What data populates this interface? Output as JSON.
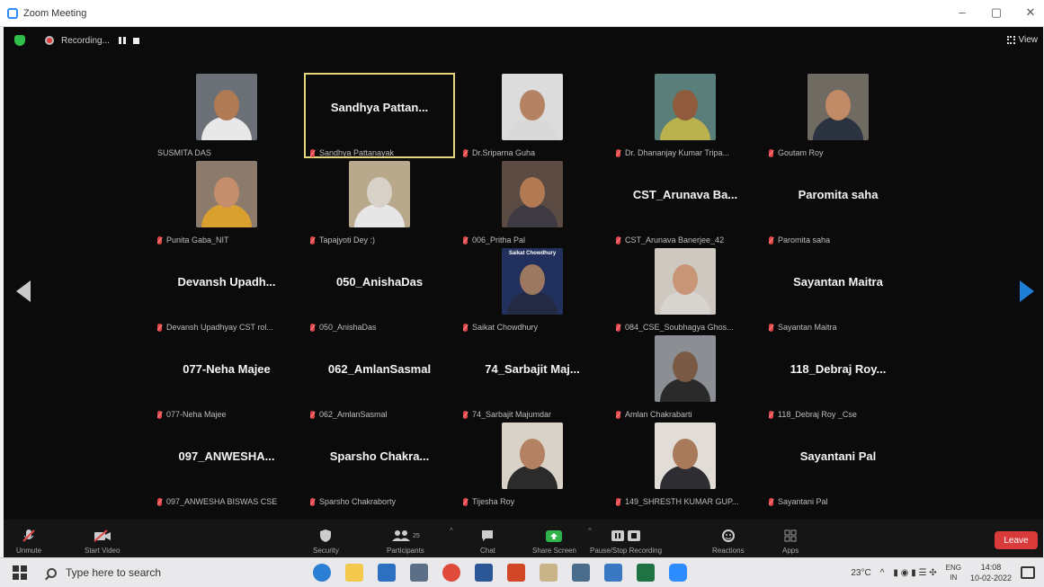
{
  "window": {
    "title": "Zoom Meeting",
    "controls": [
      "–",
      "▢",
      "✕"
    ]
  },
  "topbar": {
    "recording_label": "Recording...",
    "view_label": "View"
  },
  "participants": [
    {
      "name": "SUSMITA DAS",
      "display": "",
      "video": true,
      "active": false,
      "muted": false,
      "shirt": "#e8e8e8",
      "skin": "#b07a55",
      "bg": "#6b7076"
    },
    {
      "name": "Sandhya Pattanayak",
      "display": "Sandhya Pattan...",
      "video": false,
      "active": true,
      "muted": true
    },
    {
      "name": "Dr.Sriparna Guha",
      "display": "",
      "video": true,
      "active": false,
      "muted": true,
      "shirt": "#d9d9d9",
      "skin": "#b58363",
      "bg": "#dcdcdc"
    },
    {
      "name": "Dr. Dhananjay Kumar Tripa...",
      "display": "",
      "video": true,
      "active": false,
      "muted": true,
      "shirt": "#b9b24e",
      "skin": "#8f5b3c",
      "bg": "#5a7f7a"
    },
    {
      "name": "Goutam Roy",
      "display": "",
      "video": true,
      "active": false,
      "muted": true,
      "shirt": "#2c3340",
      "skin": "#c18b67",
      "bg": "#6f6b63"
    },
    {
      "name": "Punita Gaba_NIT",
      "display": "",
      "video": true,
      "active": false,
      "muted": true,
      "shirt": "#d9a030",
      "skin": "#c48d6b",
      "bg": "#8c7b6c"
    },
    {
      "name": "Tapajyoti Dey :)",
      "display": "",
      "video": true,
      "active": false,
      "muted": true,
      "shirt": "#e6e6e6",
      "skin": "#d7d1c7",
      "bg": "#b8a88c"
    },
    {
      "name": "006_Pritha Pal",
      "display": "",
      "video": true,
      "active": false,
      "muted": true,
      "shirt": "#3d3a44",
      "skin": "#b27a52",
      "bg": "#5c4b43"
    },
    {
      "name": "CST_Arunava Banerjee_42",
      "display": "CST_Arunava Ba...",
      "video": false,
      "active": false,
      "muted": true
    },
    {
      "name": "Paromita saha",
      "display": "Paromita saha",
      "video": false,
      "active": false,
      "muted": true
    },
    {
      "name": "Devansh Upadhyay CST rol...",
      "display": "Devansh Upadh...",
      "video": false,
      "active": false,
      "muted": true
    },
    {
      "name": "050_AnishaDas",
      "display": "050_AnishaDas",
      "video": false,
      "active": false,
      "muted": true
    },
    {
      "name": "Saikat Chowdhury",
      "display": "",
      "video": true,
      "active": false,
      "muted": true,
      "shirt": "#222a44",
      "skin": "#9c7860",
      "bg": "#22305e",
      "overlay": "Saikat Chowdhury"
    },
    {
      "name": "084_CSE_Soubhagya Ghos...",
      "display": "",
      "video": true,
      "active": false,
      "muted": true,
      "shirt": "#d8d4cf",
      "skin": "#c89676",
      "bg": "#cfc8c0"
    },
    {
      "name": "Sayantan Maitra",
      "display": "Sayantan Maitra",
      "video": false,
      "active": false,
      "muted": true
    },
    {
      "name": "077-Neha Majee",
      "display": "077-Neha Majee",
      "video": false,
      "active": false,
      "muted": true
    },
    {
      "name": "062_AmlanSasmal",
      "display": "062_AmlanSasmal",
      "video": false,
      "active": false,
      "muted": true
    },
    {
      "name": "74_Sarbajit Majumdar",
      "display": "74_Sarbajit Maj...",
      "video": false,
      "active": false,
      "muted": true
    },
    {
      "name": "Amlan Chakrabarti",
      "display": "",
      "video": true,
      "active": false,
      "muted": true,
      "shirt": "#2a2a2a",
      "skin": "#7a5a45",
      "bg": "#8b8f94"
    },
    {
      "name": "118_Debraj Roy _Cse",
      "display": "118_Debraj Roy...",
      "video": false,
      "active": false,
      "muted": true
    },
    {
      "name": "097_ANWESHA BISWAS CSE",
      "display": "097_ANWESHA...",
      "video": false,
      "active": false,
      "muted": true
    },
    {
      "name": "Sparsho Chakraborty",
      "display": "Sparsho Chakra...",
      "video": false,
      "active": false,
      "muted": true
    },
    {
      "name": "Tijesha Roy",
      "display": "",
      "video": true,
      "active": false,
      "muted": true,
      "shirt": "#2b2b2b",
      "skin": "#b48262",
      "bg": "#d9d2c8"
    },
    {
      "name": "149_SHRESTH KUMAR GUP...",
      "display": "",
      "video": true,
      "active": false,
      "muted": true,
      "shirt": "#2d2d32",
      "skin": "#a8795a",
      "bg": "#e1ddd6"
    },
    {
      "name": "Sayantani Pal",
      "display": "Sayantani Pal",
      "video": false,
      "active": false,
      "muted": true
    }
  ],
  "toolbar": {
    "unmute": "Unmute",
    "start_video": "Start Video",
    "security": "Security",
    "participants": "Participants",
    "participants_count": "25",
    "chat": "Chat",
    "share_screen": "Share Screen",
    "pause_recording": "Pause/Stop Recording",
    "reactions": "Reactions",
    "apps": "Apps",
    "leave": "Leave"
  },
  "taskbar": {
    "search_placeholder": "Type here to search",
    "temperature": "23°C",
    "lang_top": "ENG",
    "lang_bottom": "IN",
    "time": "14:08",
    "date": "10-02-2022"
  },
  "colors": {
    "share_green": "#2fb34a",
    "leave_red": "#d93a3a",
    "active_border": "#e4d77a",
    "nav_blue": "#1f7fd6"
  }
}
